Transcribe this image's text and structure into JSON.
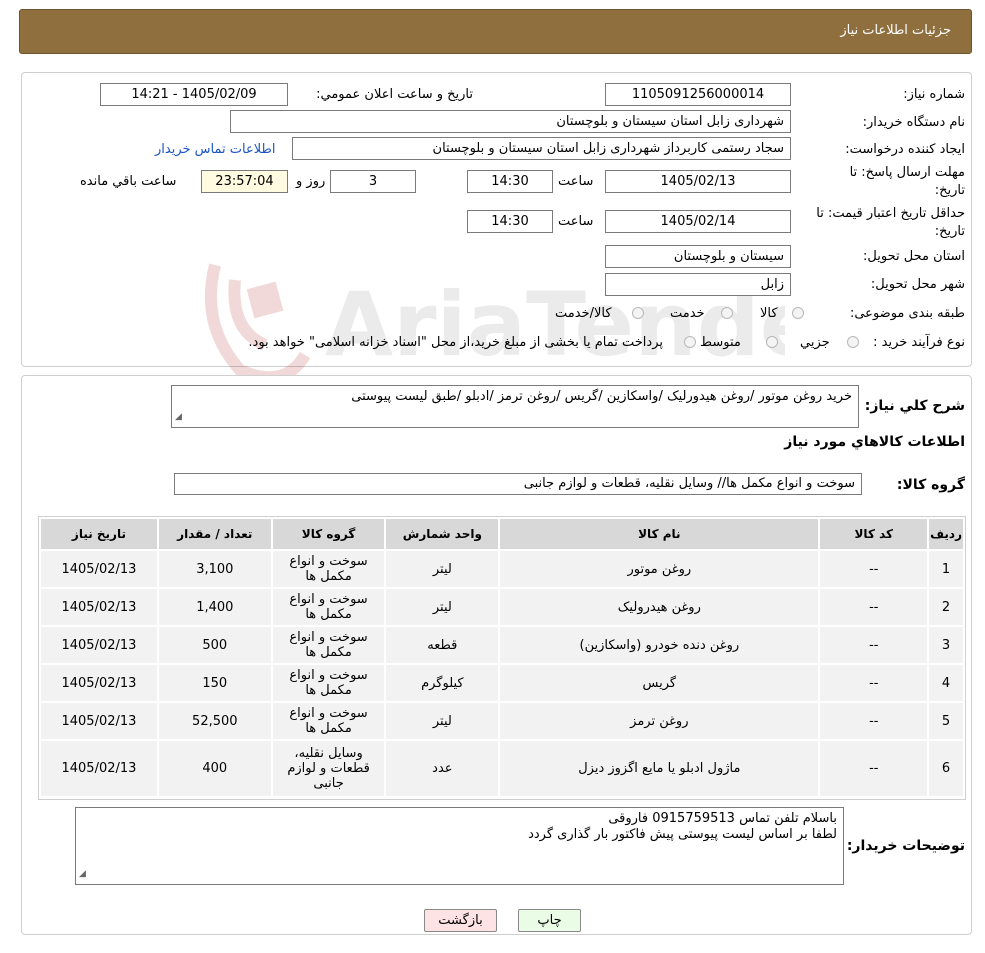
{
  "header": {
    "title": "جزئیات اطلاعات نیاز"
  },
  "form": {
    "need_number_label": "شماره نیاز:",
    "need_number": "1105091256000014",
    "announce_label": "تاریخ و ساعت اعلان عمومي:",
    "announce_value": "1405/02/09 - 14:21",
    "buyer_org_label": "نام دستگاه خریدار:",
    "buyer_org": "شهرداری زابل استان سیستان و بلوچستان",
    "creator_label": "ایجاد کننده درخواست:",
    "creator": "سجاد رستمی کاربرداز شهرداری زابل استان سیستان و بلوچستان",
    "contact_link": "اطلاعات تماس خریدار",
    "deadline_label_1": "مهلت ارسال پاسخ: تا",
    "deadline_label_2": "تاریخ:",
    "deadline_date": "1405/02/13",
    "time_label": "ساعت",
    "deadline_time": "14:30",
    "days_value": "3",
    "days_label": "روز و",
    "remaining_time": "23:57:04",
    "remaining_label": "ساعت باقي مانده",
    "validity_label_1": "حداقل تاریخ اعتبار قیمت: تا",
    "validity_label_2": "تاریخ:",
    "validity_date": "1405/02/14",
    "validity_time": "14:30",
    "province_label": "استان محل تحویل:",
    "province": "سیستان و بلوچستان",
    "city_label": "شهر محل تحویل:",
    "city": "زابل",
    "category_label": "طبقه بندی موضوعی:",
    "category_options": [
      "کالا",
      "خدمت",
      "کالا/خدمت"
    ],
    "process_label": "نوع فرآیند خرید :",
    "process_options": [
      "جزیي",
      "متوسط"
    ],
    "payment_note": "پرداخت تمام یا بخشی از مبلغ خرید،از محل \"اسناد خزانه اسلامی\" خواهد بود."
  },
  "summary": {
    "label": "شرح کلي نیاز:",
    "text": "خرید روغن موتور /روغن هیدورلیک /واسکازین /گریس /روغن ترمز /ادبلو /طبق لیست پیوستی",
    "items_title": "اطلاعات کالاهاي مورد نیاز",
    "group_label": "گروه کالا:",
    "group_value": "سوخت و انواع مکمل ها// وسایل نقلیه، قطعات و لوازم جانبی"
  },
  "table": {
    "headers": [
      "ردیف",
      "کد کالا",
      "نام کالا",
      "واحد شمارش",
      "گروه کالا",
      "تعداد / مقدار",
      "تاریخ نیاز"
    ],
    "rows": [
      {
        "row": "1",
        "code": "--",
        "name": "روغن موتور",
        "unit": "لیتر",
        "group_1": "سوخت و انواع",
        "group_2": "مکمل ها",
        "group_3": "",
        "qty": "3,100",
        "date": "1405/02/13"
      },
      {
        "row": "2",
        "code": "--",
        "name": "روغن هیدرولیک",
        "unit": "لیتر",
        "group_1": "سوخت و انواع",
        "group_2": "مکمل ها",
        "group_3": "",
        "qty": "1,400",
        "date": "1405/02/13"
      },
      {
        "row": "3",
        "code": "--",
        "name": "روغن دنده خودرو (واسکازین)",
        "unit": "قطعه",
        "group_1": "سوخت و انواع",
        "group_2": "مکمل ها",
        "group_3": "",
        "qty": "500",
        "date": "1405/02/13"
      },
      {
        "row": "4",
        "code": "--",
        "name": "گریس",
        "unit": "کیلوگرم",
        "group_1": "سوخت و انواع",
        "group_2": "مکمل ها",
        "group_3": "",
        "qty": "150",
        "date": "1405/02/13"
      },
      {
        "row": "5",
        "code": "--",
        "name": "روغن ترمز",
        "unit": "لیتر",
        "group_1": "سوخت و انواع",
        "group_2": "مکمل ها",
        "group_3": "",
        "qty": "52,500",
        "date": "1405/02/13"
      },
      {
        "row": "6",
        "code": "--",
        "name": "ماژول ادبلو یا مایع اگزوز دیزل",
        "unit": "عدد",
        "group_1": "وسایل نقلیه،",
        "group_2": "قطعات و لوازم",
        "group_3": "جانبی",
        "qty": "400",
        "date": "1405/02/13"
      }
    ]
  },
  "buyer_notes": {
    "label": "توضیحات خریدار:",
    "line1": "باسلام تلفن تماس 0915759513 فاروقی",
    "line2": "لطفا بر اساس لیست پیوستی پیش فاکتور بار گذاری گردد"
  },
  "buttons": {
    "print": "چاپ",
    "back": "بازگشت"
  },
  "watermark_text": "AriaTender.neT"
}
